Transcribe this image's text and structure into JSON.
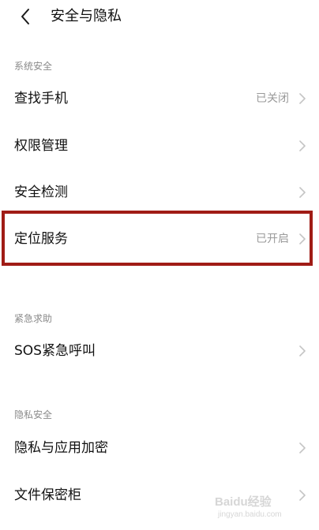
{
  "header": {
    "title": "安全与隐私",
    "back_icon": "chevron-left-icon"
  },
  "sections": [
    {
      "label": "系统安全",
      "items": [
        {
          "label": "查找手机",
          "value": "已关闭"
        },
        {
          "label": "权限管理",
          "value": ""
        },
        {
          "label": "安全检测",
          "value": ""
        },
        {
          "label": "定位服务",
          "value": "已开启"
        }
      ]
    },
    {
      "label": "紧急求助",
      "items": [
        {
          "label": "SOS紧急呼叫",
          "value": ""
        }
      ]
    },
    {
      "label": "隐私安全",
      "items": [
        {
          "label": "隐私与应用加密",
          "value": ""
        },
        {
          "label": "文件保密柜",
          "value": ""
        }
      ]
    }
  ],
  "highlight": {
    "target": "定位服务",
    "color": "#a01c16"
  },
  "watermark": {
    "logo": "Baidu经验",
    "sub": "jingyan.baidu.com"
  },
  "colors": {
    "background": "#ffffff",
    "secondary_text": "#8a8a8a",
    "chevron": "#c4c4c4"
  }
}
